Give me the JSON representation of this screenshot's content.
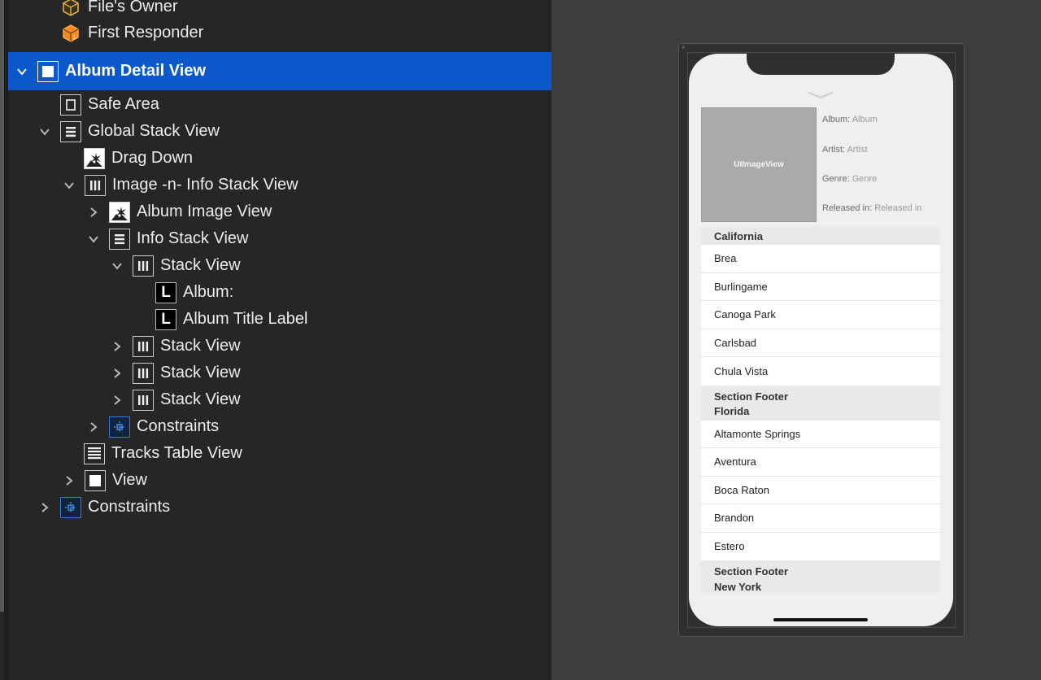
{
  "outline": {
    "items": [
      {
        "label": "File's Owner"
      },
      {
        "label": "First Responder"
      },
      {
        "label": "Album Detail View"
      },
      {
        "label": "Safe Area"
      },
      {
        "label": "Global Stack View"
      },
      {
        "label": "Drag Down"
      },
      {
        "label": "Image -n- Info Stack View"
      },
      {
        "label": "Album Image View"
      },
      {
        "label": "Info Stack View"
      },
      {
        "label": "Stack View"
      },
      {
        "label": "Album:"
      },
      {
        "label": "Album Title Label"
      },
      {
        "label": "Stack View"
      },
      {
        "label": "Stack View"
      },
      {
        "label": "Stack View"
      },
      {
        "label": "Constraints"
      },
      {
        "label": "Tracks Table View"
      },
      {
        "label": "View"
      },
      {
        "label": "Constraints"
      }
    ],
    "label_icon_letter": "L"
  },
  "device": {
    "image_placeholder": "UIImageView",
    "info": {
      "album_key": "Album:",
      "album_val": "Album",
      "artist_key": "Artist:",
      "artist_val": "Artist",
      "genre_key": "Genre:",
      "genre_val": "Genre",
      "released_key": "Released in:",
      "released_val": "Released in"
    },
    "table": {
      "sections": [
        {
          "header": "California",
          "cells": [
            "Brea",
            "Burlingame",
            "Canoga Park",
            "Carlsbad",
            "Chula Vista"
          ],
          "footer": "Section Footer"
        },
        {
          "header": "Florida",
          "cells": [
            "Altamonte Springs",
            "Aventura",
            "Boca Raton",
            "Brandon",
            "Estero"
          ],
          "footer": "Section Footer"
        },
        {
          "header": "New York"
        }
      ]
    }
  },
  "colors": {
    "selection": "#0a58ca",
    "panel": "#262626",
    "canvas": "#3d3d3d",
    "placeholder_icon": "#f0a030"
  }
}
